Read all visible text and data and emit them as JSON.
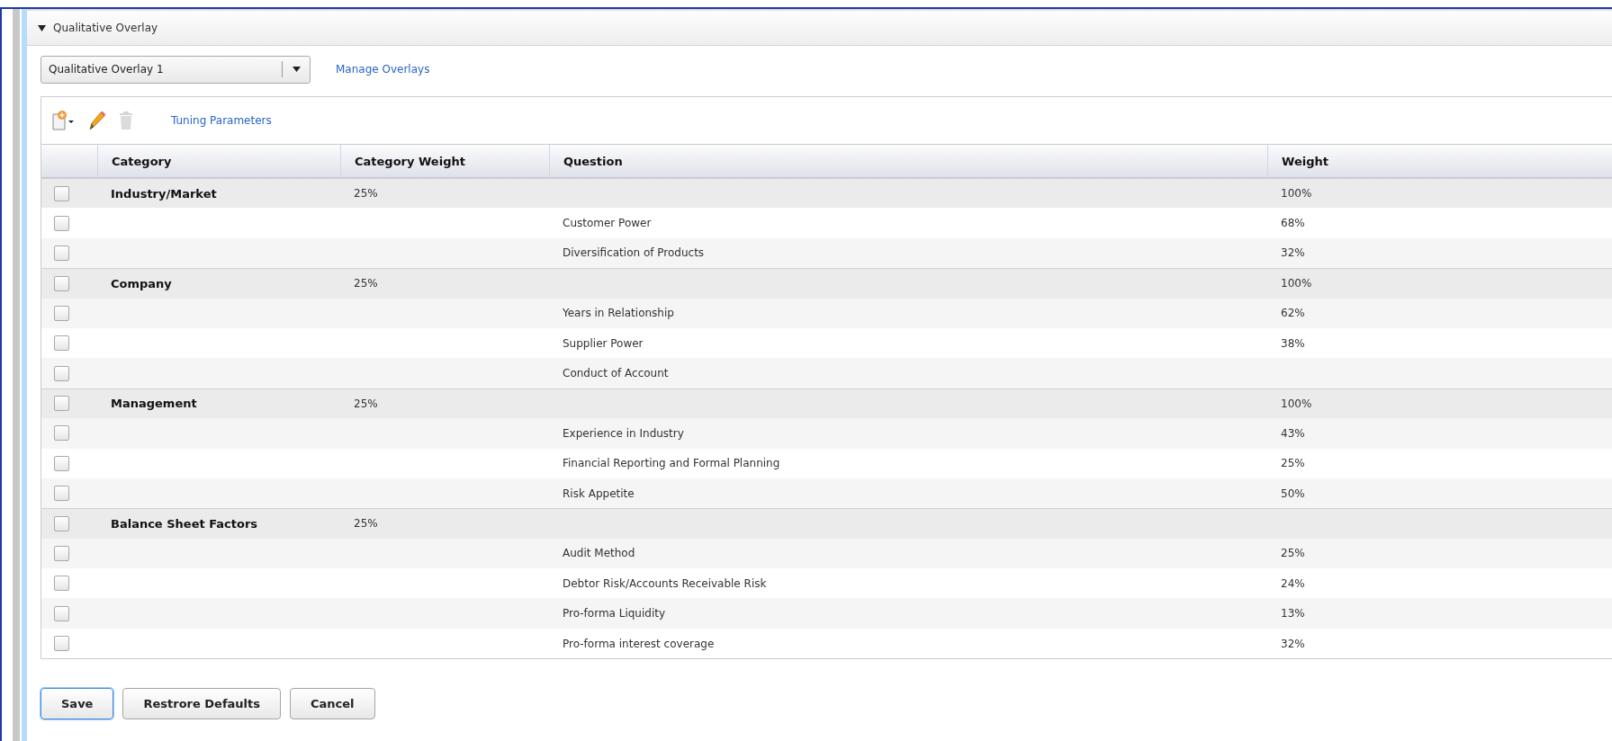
{
  "section": {
    "title": "Qualitative Overlay",
    "expanded": true
  },
  "overlay_select": {
    "value": "Qualitative Overlay 1"
  },
  "manage_link": "Manage Overlays",
  "toolbar": {
    "delete_disabled": true,
    "link": "Tuning Parameters"
  },
  "table": {
    "columns": [
      "Category",
      "Category Weight",
      "Question",
      "Weight"
    ],
    "rows": [
      {
        "kind": "category",
        "checked": false,
        "category": "Industry/Market",
        "category_weight": "25%",
        "weight": "100%"
      },
      {
        "kind": "question",
        "checked": false,
        "question": "Customer Power",
        "weight": "68%"
      },
      {
        "kind": "question",
        "checked": false,
        "question": "Diversification of Products",
        "weight": "32%"
      },
      {
        "kind": "category",
        "checked": false,
        "category": "Company",
        "category_weight": "25%",
        "weight": "100%"
      },
      {
        "kind": "question",
        "checked": false,
        "question": "Years in Relationship",
        "weight": "62%"
      },
      {
        "kind": "question",
        "checked": false,
        "question": "Supplier Power",
        "weight": "38%"
      },
      {
        "kind": "question",
        "checked": false,
        "question": "Conduct of Account"
      },
      {
        "kind": "category",
        "checked": false,
        "category": "Management",
        "category_weight": "25%",
        "weight": "100%"
      },
      {
        "kind": "question",
        "checked": false,
        "question": "Experience in Industry",
        "weight": "43%"
      },
      {
        "kind": "question",
        "checked": false,
        "question": "Financial Reporting and Formal Planning",
        "weight": "25%"
      },
      {
        "kind": "question",
        "checked": false,
        "question": "Risk Appetite",
        "weight": "50%"
      },
      {
        "kind": "category",
        "checked": false,
        "category": "Balance Sheet Factors",
        "category_weight": "25%"
      },
      {
        "kind": "question",
        "checked": false,
        "question": "Audit Method",
        "weight": "25%"
      },
      {
        "kind": "question",
        "checked": false,
        "question": "Debtor Risk/Accounts Receivable Risk",
        "weight": "24%"
      },
      {
        "kind": "question",
        "checked": false,
        "question": "Pro-forma Liquidity",
        "weight": "13%"
      },
      {
        "kind": "question",
        "checked": false,
        "question": "Pro-forma interest coverage",
        "weight": "32%"
      }
    ]
  },
  "buttons": [
    {
      "label": "Save",
      "focused": true
    },
    {
      "label": "Restrore Defaults",
      "focused": false
    },
    {
      "label": "Cancel",
      "focused": false
    }
  ]
}
